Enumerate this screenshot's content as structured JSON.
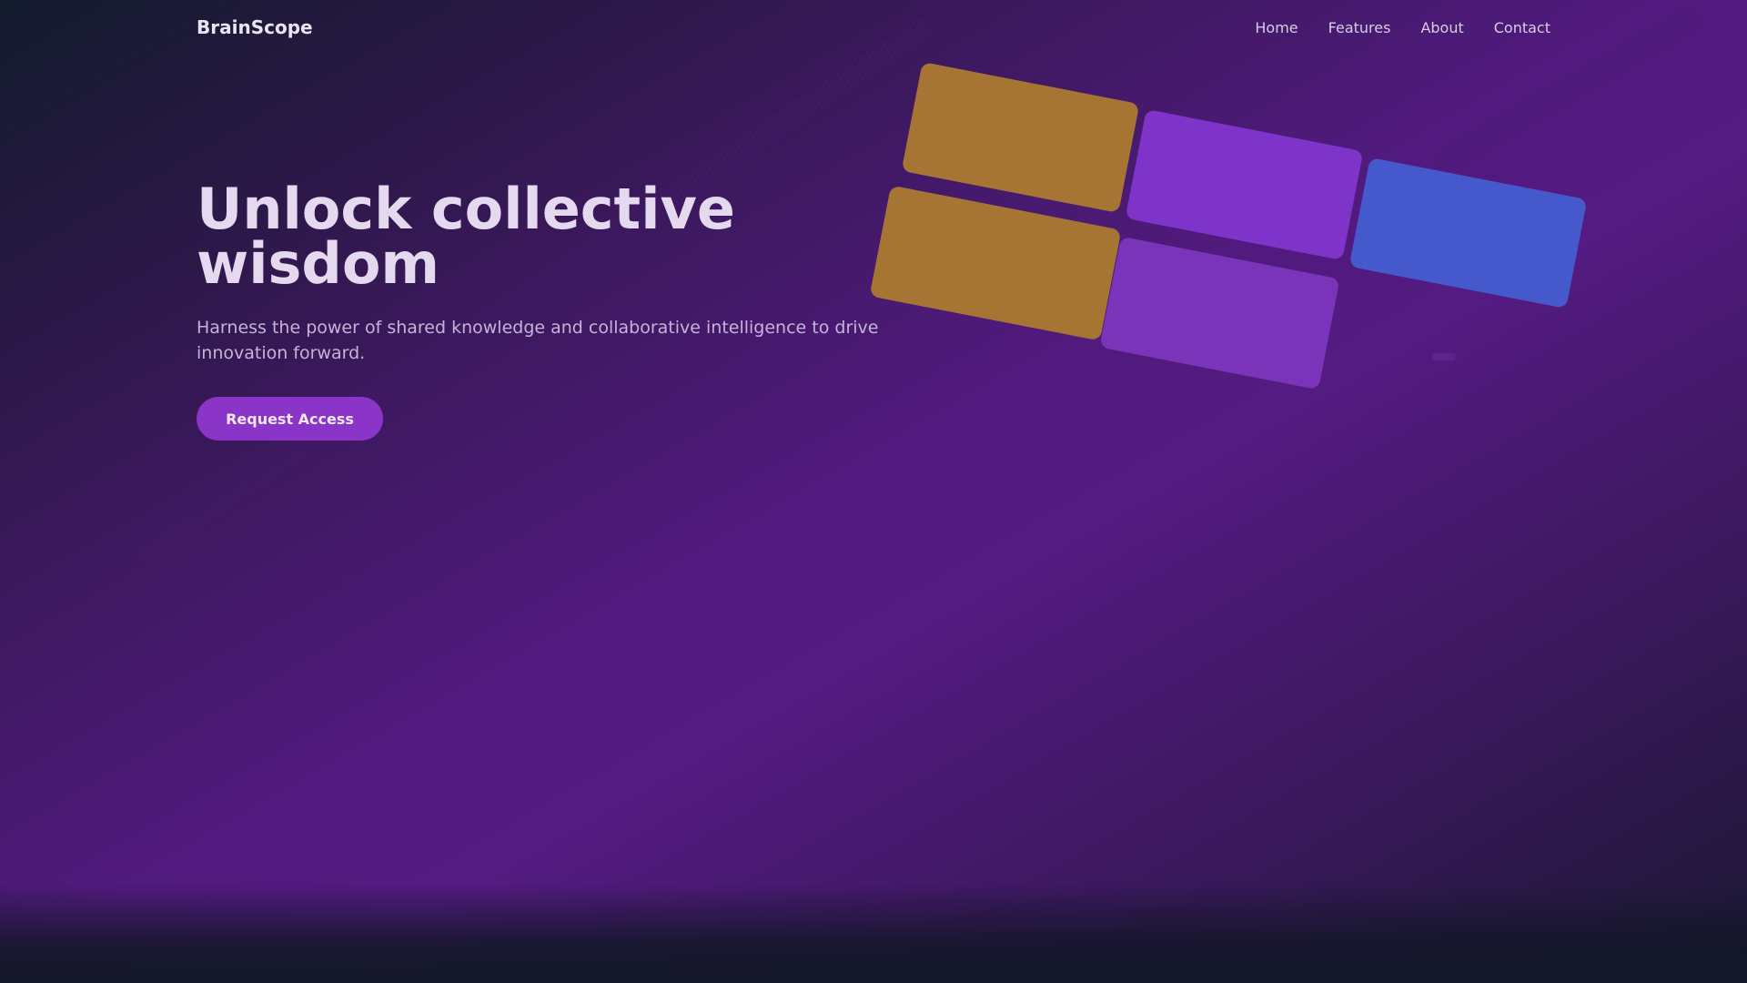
{
  "nav": {
    "brand": "BrainScope",
    "links": [
      "Home",
      "Features",
      "About",
      "Contact"
    ]
  },
  "hero": {
    "title": "Unlock collective wisdom",
    "subtitle": "Harness the power of shared knowledge and collaborative intelligence to drive innovation forward.",
    "cta_label": "Request Access"
  },
  "colors": {
    "accent": "#8a35c8",
    "tile_amber": "#a67433",
    "tile_purple": "#7e34c9",
    "tile_blue": "#4659cc",
    "background_dark": "#121a2c",
    "background_purple": "#541b82"
  }
}
